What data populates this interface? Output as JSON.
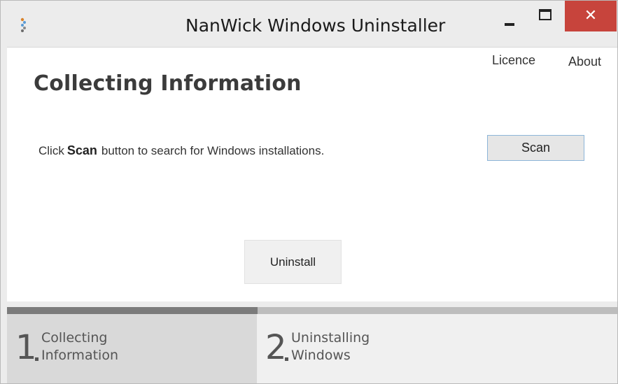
{
  "window": {
    "title": "NanWick Windows Uninstaller",
    "minimize_icon": "minimize-icon",
    "maximize_icon": "maximize-icon",
    "close_icon": "close-icon",
    "close_glyph": "✕",
    "close_color": "#c7443c"
  },
  "header_links": {
    "licence": "Licence",
    "about": "About"
  },
  "main": {
    "heading": "Collecting Information",
    "instruction_prefix": "Click",
    "instruction_bold": "Scan",
    "instruction_suffix": "button to search for Windows installations.",
    "scan_button": "Scan",
    "uninstall_button": "Uninstall"
  },
  "progress": {
    "current_step": 1,
    "total_steps": 2,
    "fraction": 0.41
  },
  "steps": [
    {
      "number": "1",
      "line1": "Collecting",
      "line2": "Information",
      "active": true
    },
    {
      "number": "2",
      "line1": "Uninstalling",
      "line2": "Windows",
      "active": false
    }
  ]
}
